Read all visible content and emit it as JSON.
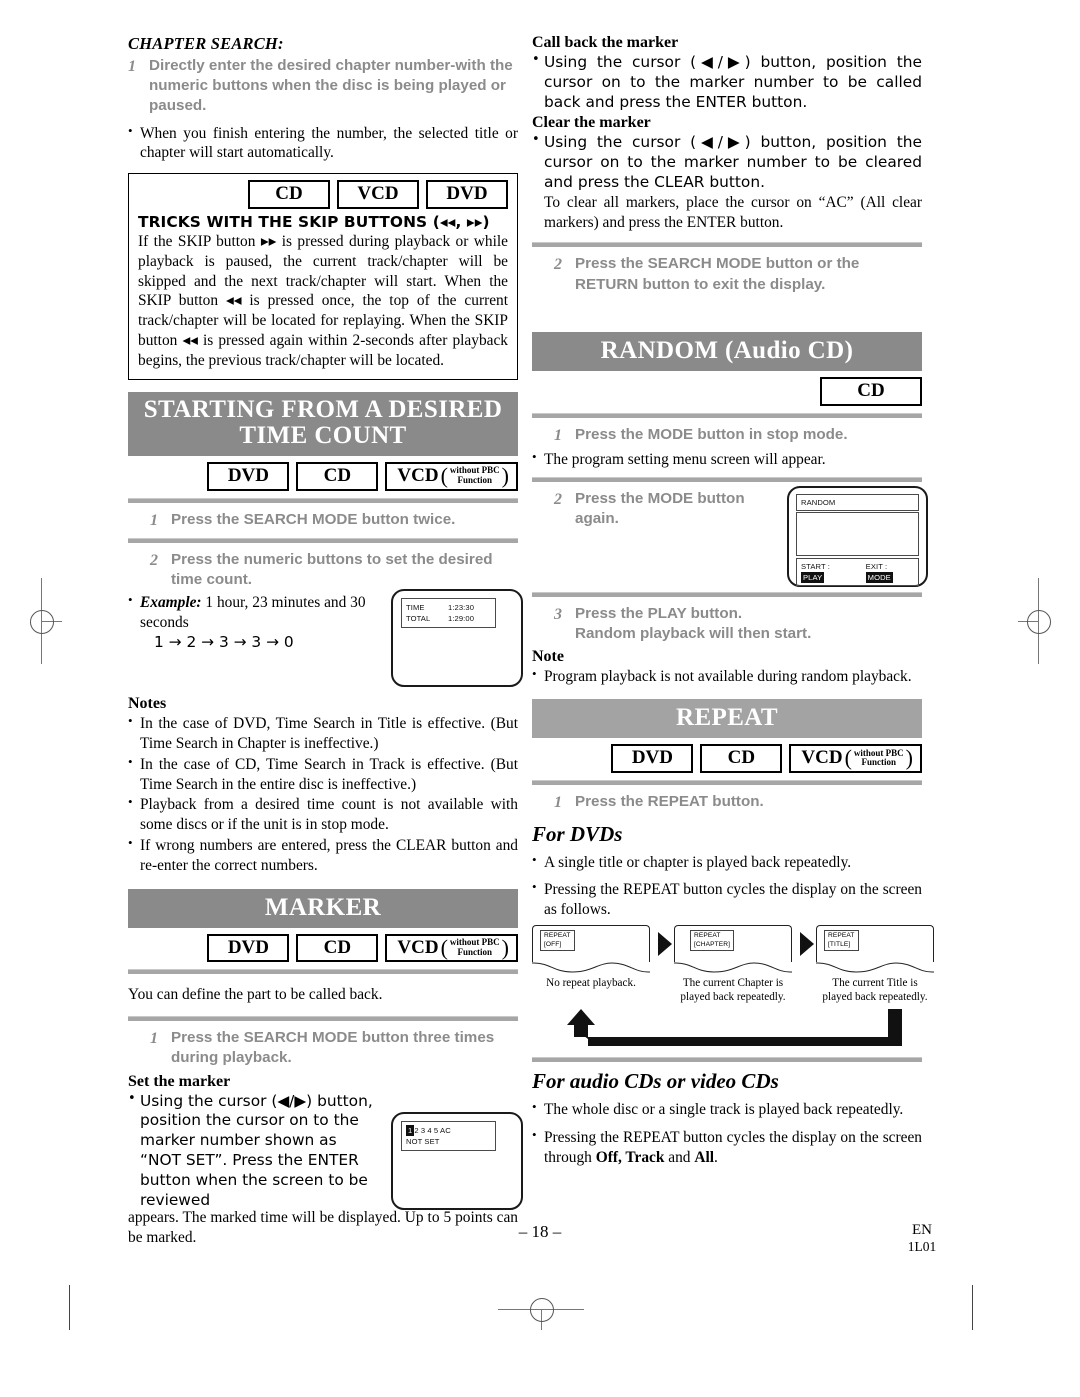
{
  "page": {
    "number_label": "– 18 –",
    "lang_code": "EN",
    "doc_code": "1L01"
  },
  "left_column": {
    "chapter_search": {
      "heading": "CHAPTER SEARCH:",
      "step1_num": "1",
      "step1_text": "Directly enter the desired chapter number-with the numeric buttons when the disc is being played or paused.",
      "bullet1": "When you finish entering the number, the selected title or chapter will start automatically."
    },
    "tricks_box": {
      "badges": [
        "CD",
        "VCD",
        "DVD"
      ],
      "title": "TRICKS WITH THE SKIP BUTTONS (◂◂, ▸▸)",
      "body": "If the SKIP button ▸▸ is pressed during playback or while playback is paused, the current track/chapter will be skipped and the next track/chapter will start. When the SKIP button ◂◂ is pressed once, the top of the current track/chapter will be located for replaying. When the SKIP button ◂◂ is pressed again within 2-seconds after playback begins, the previous track/chapter will be located."
    },
    "time_count": {
      "banner_line1": "STARTING FROM A DESIRED",
      "banner_line2": "TIME COUNT",
      "badge_dvd": "DVD",
      "badge_cd": "CD",
      "badge_vcd": "VCD",
      "badge_vcd_sub1": "without PBC",
      "badge_vcd_sub2": "Function",
      "step1_num": "1",
      "step1_text": "Press the SEARCH MODE button twice.",
      "step2_num": "2",
      "step2_text": "Press the numeric buttons to set the desired time count.",
      "example_label": "Example:",
      "example_text": "1 hour, 23 minutes and 30 seconds",
      "example_sequence": "1 → 2 → 3 → 3 → 0",
      "osd": {
        "time_label": "TIME",
        "time_value": "1:23:30",
        "total_label": "TOTAL",
        "total_value": "1:29:00"
      },
      "notes_heading": "Notes",
      "notes": [
        "In the case of DVD, Time Search in Title is effective. (But Time Search in Chapter is ineffective.)",
        "In the case of CD, Time Search in Track is effective. (But Time Search in the entire disc is ineffective.)",
        "Playback from a desired time count is not available with some discs or if the unit is in stop mode.",
        "If wrong numbers are entered, press the CLEAR button and re-enter the correct numbers."
      ]
    },
    "marker": {
      "banner": "MARKER",
      "badge_dvd": "DVD",
      "badge_cd": "CD",
      "badge_vcd": "VCD",
      "badge_vcd_sub1": "without PBC",
      "badge_vcd_sub2": "Function",
      "intro": "You can define the part to be called back.",
      "step1_num": "1",
      "step1_text": "Press the SEARCH MODE button three times during playback.",
      "set_heading": "Set the marker",
      "set_body_part1": "Using the cursor (◀/▶) button, position the cursor on to the marker number shown as “NOT SET”. Press the ENTER button when the screen to be reviewed",
      "set_body_part2": "appears. The marked time will be displayed. Up to 5 points can be marked.",
      "osd": {
        "markers": "2 3 4 5 AC",
        "selected": "1",
        "status": "NOT SET"
      }
    }
  },
  "right_column": {
    "marker_cont": {
      "callback_heading": "Call back the marker",
      "callback_body": "Using the cursor (◀/▶) button, position the cursor on to the marker number to be called back and press the ENTER button.",
      "clear_heading": "Clear the marker",
      "clear_body": "Using the cursor (◀/▶) button, position the cursor on to the marker number to be cleared and press the CLEAR button.",
      "clear_all": "To clear all markers, place the cursor on “AC” (All clear markers) and press the ENTER button.",
      "step2_num": "2",
      "step2_text": "Press the SEARCH MODE button or the RETURN button to exit the display."
    },
    "random": {
      "banner": "RANDOM (Audio CD)",
      "badge_cd": "CD",
      "step1_num": "1",
      "step1_text": "Press the MODE button in stop mode.",
      "bullet1": "The program setting menu screen will appear.",
      "step2_num": "2",
      "step2_text": "Press the MODE button again.",
      "osd": {
        "title": "RANDOM",
        "start_label": "START :",
        "start_value": "PLAY",
        "exit_label": "EXIT :",
        "exit_value": "MODE"
      },
      "step3_num": "3",
      "step3_text_line1": "Press the PLAY button.",
      "step3_text_line2": "Random playback will then start.",
      "note_heading": "Note",
      "note_body": "Program playback is not available during random playback."
    },
    "repeat": {
      "banner": "REPEAT",
      "badge_dvd": "DVD",
      "badge_cd": "CD",
      "badge_vcd": "VCD",
      "badge_vcd_sub1": "without PBC",
      "badge_vcd_sub2": "Function",
      "step1_num": "1",
      "step1_text": "Press the REPEAT button.",
      "for_dvds_heading": "For DVDs",
      "dvd_bullet1": "A single title or chapter is played back repeatedly.",
      "dvd_bullet2": "Pressing the REPEAT button cycles the display on the screen as follows.",
      "cycle": [
        {
          "tag_line1": "REPEAT",
          "tag_line2": "[OFF]",
          "caption": "No repeat playback."
        },
        {
          "tag_line1": "REPEAT",
          "tag_line2": "[CHAPTER]",
          "caption": "The current Chapter is played back repeatedly."
        },
        {
          "tag_line1": "REPEAT",
          "tag_line2": "[TITLE]",
          "caption": "The current Title is played back repeatedly."
        }
      ],
      "for_cds_heading": "For audio CDs or video CDs",
      "cd_bullet1": "The whole disc or a single track is played back repeatedly.",
      "cd_bullet2_pre": "Pressing the REPEAT button cycles the display on the screen through ",
      "cd_bullet2_bold1": "Off, Track",
      "cd_bullet2_mid": " and ",
      "cd_bullet2_bold2": "All",
      "cd_bullet2_end": "."
    }
  },
  "colors": {
    "banner_dark": "#8a8a8a",
    "banner_light": "#a3a3a3",
    "rule": "#a6a6a6",
    "step_text": "#8b8b8b"
  }
}
